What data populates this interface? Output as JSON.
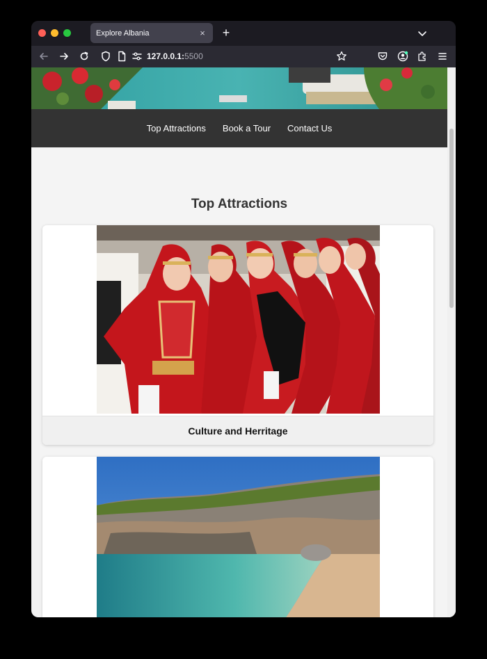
{
  "browser": {
    "tab_title": "Explore Albania",
    "tab_close": "×",
    "new_tab": "+",
    "url_host": "127.0.0.1:",
    "url_port": "5500",
    "icons": [
      "back-icon",
      "forward-icon",
      "reload-icon",
      "shield-icon",
      "page-icon",
      "permissions-icon",
      "bookmark-star-icon",
      "pocket-icon",
      "account-icon",
      "extensions-icon",
      "menu-icon",
      "tab-list-chevron-icon"
    ]
  },
  "site": {
    "nav": [
      "Top Attractions",
      "Book a Tour",
      "Contact Us"
    ],
    "section_title": "Top Attractions",
    "cards": [
      {
        "caption": "Culture and Herritage",
        "image": "folk-dancers-photo"
      },
      {
        "caption": "",
        "image": "coastal-beach-photo"
      }
    ]
  },
  "colors": {
    "site_nav_bg": "#333333",
    "page_bg": "#f4f4f4",
    "browser_chrome": "#1c1b22"
  }
}
